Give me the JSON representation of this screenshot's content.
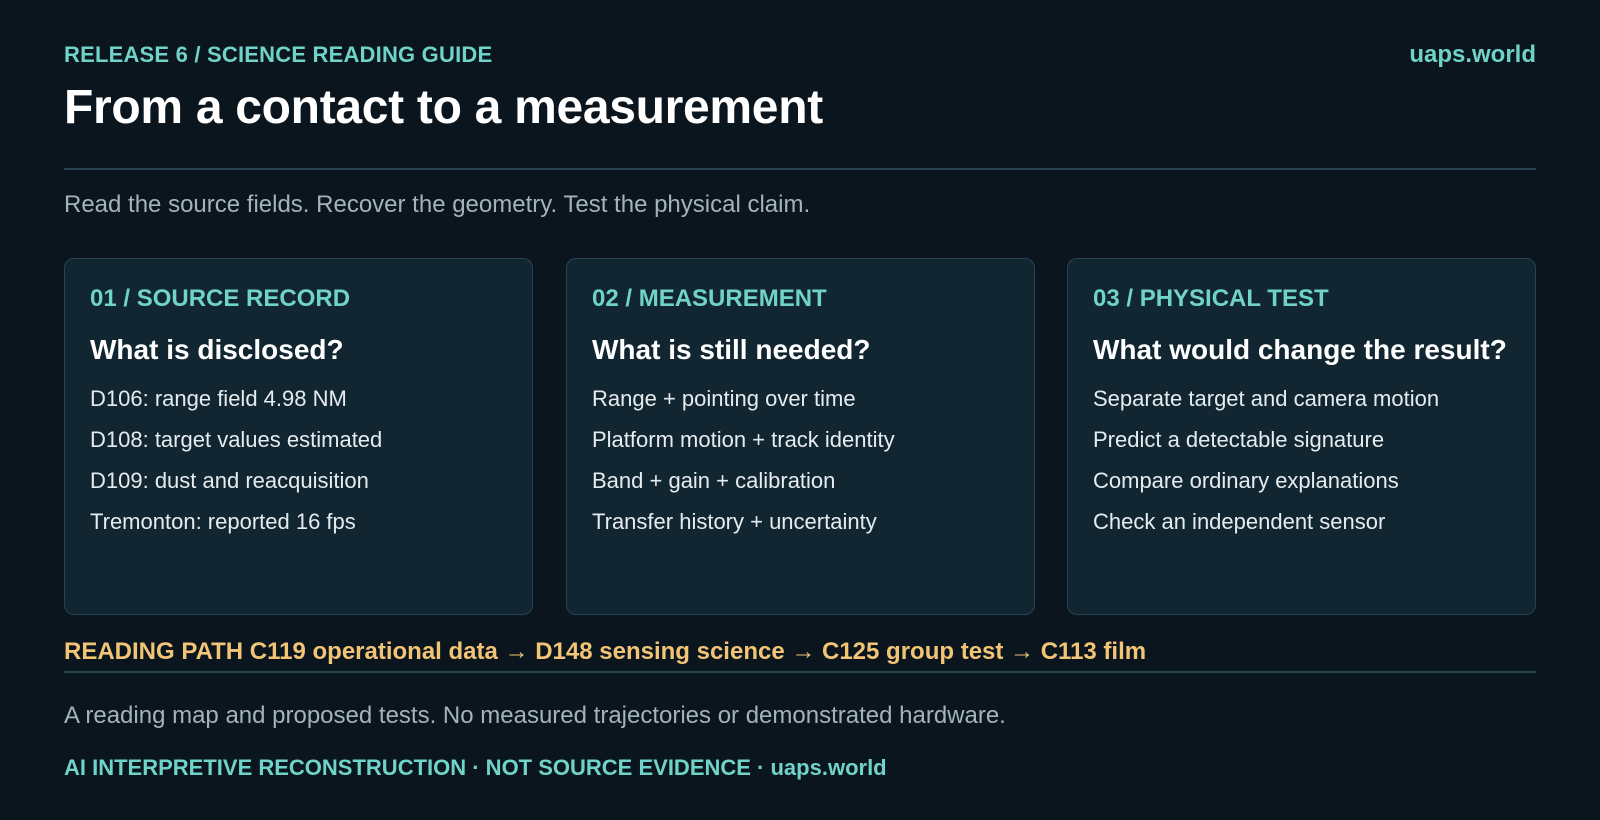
{
  "header": {
    "kicker": "RELEASE 6 / SCIENCE READING GUIDE",
    "site": "uaps.world",
    "title": "From a contact to a measurement",
    "subtitle": "Read the source fields. Recover the geometry. Test the physical claim."
  },
  "cards": [
    {
      "label": "01 / SOURCE RECORD",
      "question": "What is disclosed?",
      "items": [
        "D106: range field 4.98 NM",
        "D108: target values estimated",
        "D109: dust and reacquisition",
        "Tremonton: reported 16 fps"
      ]
    },
    {
      "label": "02 / MEASUREMENT",
      "question": "What is still needed?",
      "items": [
        "Range + pointing over time",
        "Platform motion + track identity",
        "Band + gain + calibration",
        "Transfer history + uncertainty"
      ]
    },
    {
      "label": "03 / PHYSICAL TEST",
      "question": "What would change the result?",
      "items": [
        "Separate target and camera motion",
        "Predict a detectable signature",
        "Compare ordinary explanations",
        "Check an independent sensor"
      ]
    }
  ],
  "reading_path": "READING PATH C119 operational data → D148 sensing science → C125 group test → C113 film",
  "note": "A reading map and proposed tests. No measured trajectories or demonstrated hardware.",
  "footer": "AI INTERPRETIVE RECONSTRUCTION · NOT SOURCE EVIDENCE · uaps.world",
  "colors": {
    "background": "#0b151e",
    "accent": "#6fd3c9",
    "path": "#f2c476",
    "card": "#122632"
  }
}
